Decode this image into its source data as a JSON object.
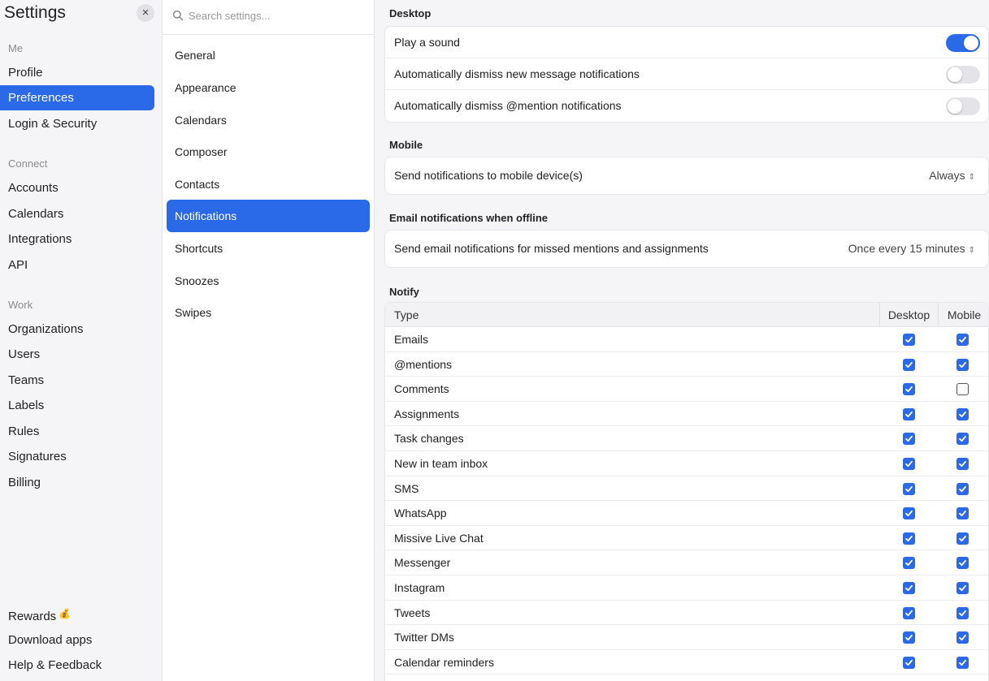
{
  "sidebar": {
    "title": "Settings",
    "close_icon": "×",
    "sections": [
      {
        "label": "Me",
        "items": [
          "Profile",
          "Preferences",
          "Login & Security"
        ]
      },
      {
        "label": "Connect",
        "items": [
          "Accounts",
          "Calendars",
          "Integrations",
          "API"
        ]
      },
      {
        "label": "Work",
        "items": [
          "Organizations",
          "Users",
          "Teams",
          "Labels",
          "Rules",
          "Signatures",
          "Billing"
        ]
      }
    ],
    "active_item": "Preferences",
    "bottom": [
      "Rewards",
      "Download apps",
      "Help & Feedback"
    ],
    "rewards_emoji": "💰"
  },
  "middle": {
    "search_placeholder": "Search settings...",
    "items": [
      "General",
      "Appearance",
      "Calendars",
      "Composer",
      "Contacts",
      "Notifications",
      "Shortcuts",
      "Snoozes",
      "Swipes"
    ],
    "active_item": "Notifications"
  },
  "content": {
    "desktop": {
      "title": "Desktop",
      "rows": [
        {
          "label": "Play a sound",
          "on": true
        },
        {
          "label": "Automatically dismiss new message notifications",
          "on": false
        },
        {
          "label": "Automatically dismiss @mention notifications",
          "on": false
        }
      ]
    },
    "mobile": {
      "title": "Mobile",
      "label": "Send notifications to mobile device(s)",
      "value": "Always",
      "chevron": "⌃⌄"
    },
    "email": {
      "title": "Email notifications when offline",
      "label": "Send email notifications for missed mentions and assignments",
      "value": "Once every 15 minutes",
      "chevron": "⌃⌄"
    },
    "notify": {
      "title": "Notify",
      "headers": {
        "type": "Type",
        "desktop": "Desktop",
        "mobile": "Mobile"
      },
      "rows": [
        {
          "type": "Emails",
          "desktop": true,
          "mobile": true
        },
        {
          "type": "@mentions",
          "desktop": true,
          "mobile": true
        },
        {
          "type": "Comments",
          "desktop": true,
          "mobile": false
        },
        {
          "type": "Assignments",
          "desktop": true,
          "mobile": true
        },
        {
          "type": "Task changes",
          "desktop": true,
          "mobile": true
        },
        {
          "type": "New in team inbox",
          "desktop": true,
          "mobile": true
        },
        {
          "type": "SMS",
          "desktop": true,
          "mobile": true
        },
        {
          "type": "WhatsApp",
          "desktop": true,
          "mobile": true
        },
        {
          "type": "Missive Live Chat",
          "desktop": true,
          "mobile": true
        },
        {
          "type": "Messenger",
          "desktop": true,
          "mobile": true
        },
        {
          "type": "Instagram",
          "desktop": true,
          "mobile": true
        },
        {
          "type": "Tweets",
          "desktop": true,
          "mobile": true
        },
        {
          "type": "Twitter DMs",
          "desktop": true,
          "mobile": true
        },
        {
          "type": "Calendar reminders",
          "desktop": true,
          "mobile": true
        },
        {
          "type": "",
          "desktop": true,
          "mobile": true
        }
      ]
    }
  },
  "colors": {
    "accent": "#2a6ae8",
    "sidebar_bg": "#f5f5f7"
  }
}
